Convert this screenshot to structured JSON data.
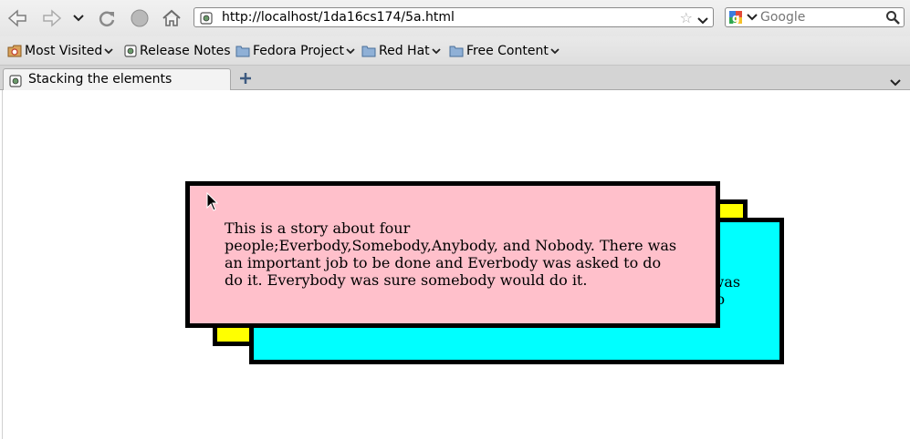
{
  "browser": {
    "url": "http://localhost/1da16cs174/5a.html",
    "search": {
      "placeholder": "Google"
    },
    "bookmarks": [
      {
        "label": "Most Visited",
        "icon": "most-visited-icon"
      },
      {
        "label": "Release Notes",
        "icon": "page-icon"
      },
      {
        "label": "Fedora Project",
        "icon": "folder-icon"
      },
      {
        "label": "Red Hat",
        "icon": "folder-icon"
      },
      {
        "label": "Free Content",
        "icon": "folder-icon"
      }
    ],
    "tab": {
      "title": "Stacking the elements"
    }
  },
  "page": {
    "story": "This is a story about four people;Everbody,Somebody,Anybody, and Nobody. There was an important job to be done and Everbody was asked to do do it. Everybody was sure somebody would do it.",
    "colors": {
      "pink": "#ffc0cb",
      "cyan": "#00ffff",
      "yellow": "#ffff00",
      "border": "#000000"
    }
  }
}
